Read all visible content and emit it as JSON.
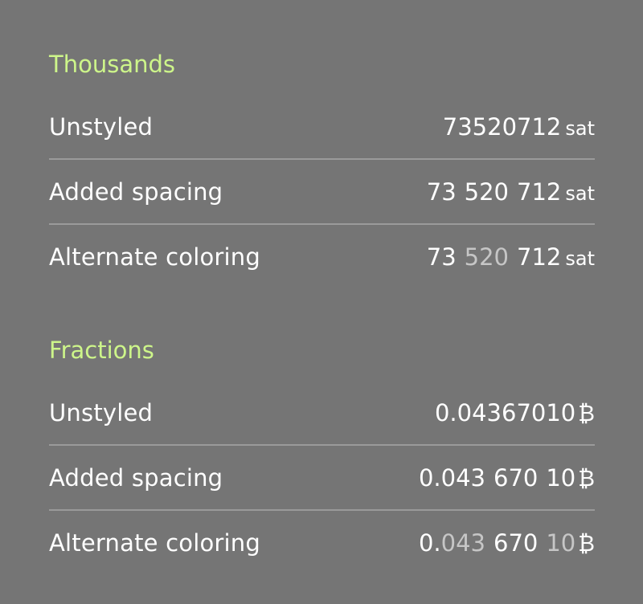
{
  "colors": {
    "background": "#757575",
    "heading": "#cdf58a",
    "text": "#ffffff",
    "muted": "#c6c6c6",
    "divider": "#9a9a9a"
  },
  "thousands": {
    "title": "Thousands",
    "unit": "sat",
    "rows": [
      {
        "label": "Unstyled",
        "value": "73520712"
      },
      {
        "label": "Added spacing",
        "groups": [
          "73",
          "520",
          "712"
        ]
      },
      {
        "label": "Alternate coloring",
        "groups": [
          "73",
          "520",
          "712"
        ]
      }
    ]
  },
  "fractions": {
    "title": "Fractions",
    "unit": "₿",
    "rows": [
      {
        "label": "Unstyled",
        "value": "0.04367010"
      },
      {
        "label": "Added spacing",
        "groups": [
          "0.043",
          "670",
          "10"
        ]
      },
      {
        "label": "Alternate coloring",
        "groups": [
          "0.",
          "043",
          "670",
          "10"
        ]
      }
    ]
  }
}
